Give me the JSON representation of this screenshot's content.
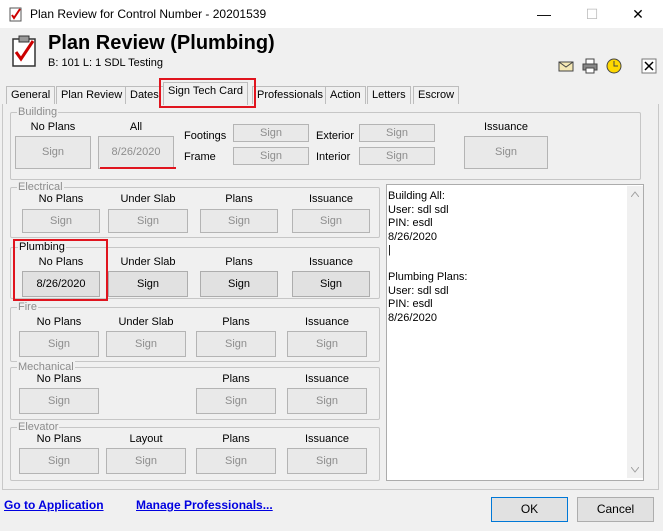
{
  "window": {
    "title": "Plan Review for Control Number - 20201539",
    "minimize": "—",
    "maximize": "☐",
    "close": "✕"
  },
  "header": {
    "title": "Plan Review (Plumbing)",
    "subtitle": "B: 101   L: 1  SDL Testing"
  },
  "toolbar": {
    "icons": [
      "mail-icon",
      "print-icon",
      "clock-icon",
      "close-icon"
    ]
  },
  "tabs": [
    {
      "label": "General"
    },
    {
      "label": "Plan Review"
    },
    {
      "label": "Dates"
    },
    {
      "label": "Sign Tech Card",
      "active": true
    },
    {
      "label": "Professionals"
    },
    {
      "label": "Action"
    },
    {
      "label": "Letters"
    },
    {
      "label": "Escrow"
    }
  ],
  "building": {
    "label": "Building",
    "no_plans": {
      "label": "No Plans",
      "button": "Sign"
    },
    "all": {
      "label": "All",
      "button": "8/26/2020"
    },
    "footings": {
      "label": "Footings",
      "button": "Sign"
    },
    "frame": {
      "label": "Frame",
      "button": "Sign"
    },
    "exterior": {
      "label": "Exterior",
      "button": "Sign"
    },
    "interior": {
      "label": "Interior",
      "button": "Sign"
    },
    "issuance": {
      "label": "Issuance",
      "button": "Sign"
    }
  },
  "electrical": {
    "label": "Electrical",
    "cols": [
      "No Plans",
      "Under Slab",
      "Plans",
      "Issuance"
    ],
    "buttons": [
      "Sign",
      "Sign",
      "Sign",
      "Sign"
    ]
  },
  "plumbing": {
    "label": "Plumbing",
    "cols": [
      "No Plans",
      "Under Slab",
      "Plans",
      "Issuance"
    ],
    "buttons": [
      "8/26/2020",
      "Sign",
      "Sign",
      "Sign"
    ]
  },
  "fire": {
    "label": "Fire",
    "cols": [
      "No Plans",
      "Under Slab",
      "Plans",
      "Issuance"
    ],
    "buttons": [
      "Sign",
      "Sign",
      "Sign",
      "Sign"
    ]
  },
  "mechanical": {
    "label": "Mechanical",
    "cols": [
      "No Plans",
      "Plans",
      "Issuance"
    ],
    "buttons": [
      "Sign",
      "Sign",
      "Sign"
    ]
  },
  "elevator": {
    "label": "Elevator",
    "cols": [
      "No Plans",
      "Layout",
      "Plans",
      "Issuance"
    ],
    "buttons": [
      "Sign",
      "Sign",
      "Sign",
      "Sign"
    ]
  },
  "notes": {
    "text": "Building All:\nUser: sdl sdl\nPIN: esdl\n8/26/2020\n|\n\nPlumbing Plans:\nUser: sdl sdl\nPIN: esdl\n8/26/2020"
  },
  "footer": {
    "go_to_application": "Go to Application",
    "manage_professionals": "Manage Professionals...",
    "ok": "OK",
    "cancel": "Cancel"
  },
  "colors": {
    "highlight": "#e0141e",
    "link": "#0000e0"
  }
}
